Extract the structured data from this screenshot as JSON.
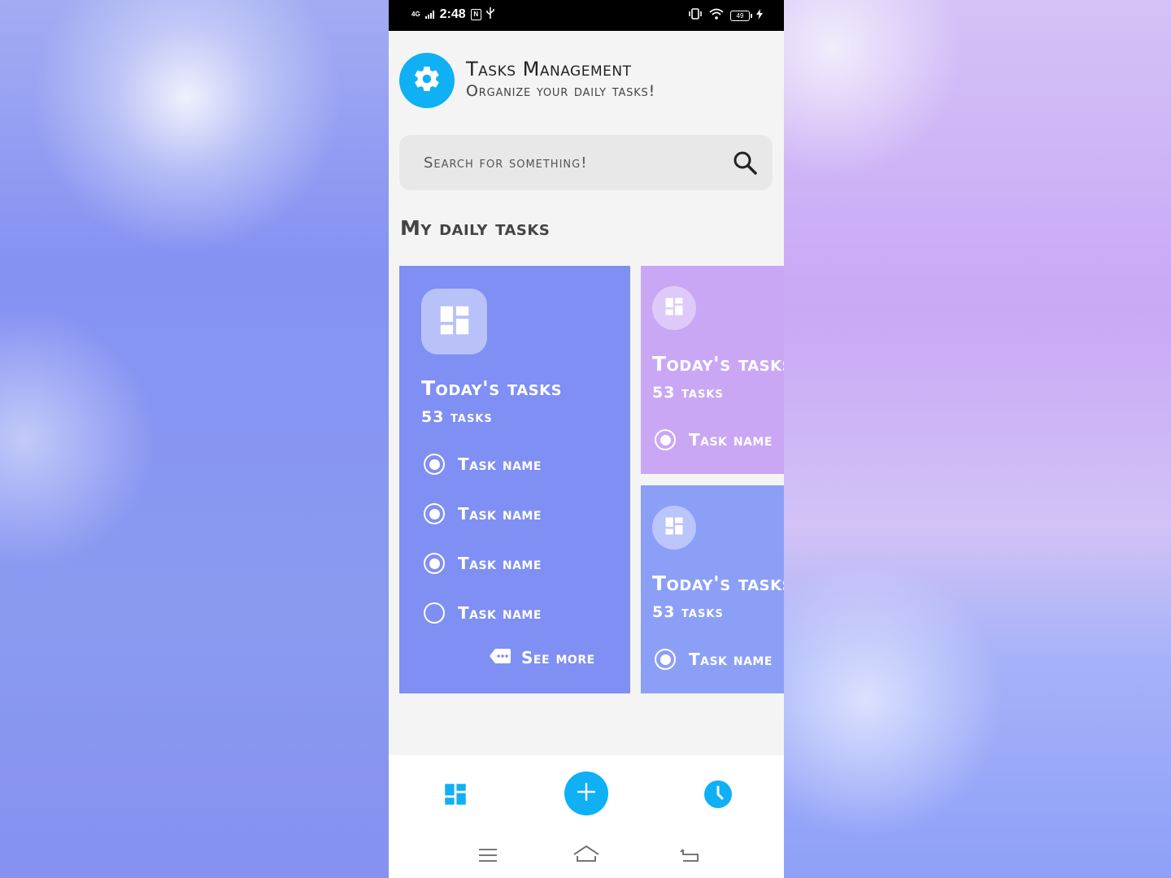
{
  "status_bar": {
    "network": "4G",
    "time": "2:48",
    "battery": "49"
  },
  "header": {
    "title": "Tasks Management",
    "subtitle": "Organize your daily tasks!",
    "icon": "gear-icon"
  },
  "search": {
    "placeholder": "Search for something!",
    "icon": "search-icon"
  },
  "section": {
    "title": "My daily tasks"
  },
  "cards": [
    {
      "title": "Today's tasks",
      "count": "53 tasks",
      "color": "#7f8ff3",
      "tasks": [
        {
          "label": "Task name",
          "checked": true
        },
        {
          "label": "Task name",
          "checked": true
        },
        {
          "label": "Task name",
          "checked": true
        },
        {
          "label": "Task name",
          "checked": false
        }
      ],
      "see_more": "See more"
    },
    {
      "title": "Today's tasks",
      "count": "53 tasks",
      "color": "#c9a7f4",
      "tasks": [
        {
          "label": "Task name",
          "checked": true
        }
      ]
    },
    {
      "title": "Today's tasks",
      "count": "53 tasks",
      "color": "#8c9ff7",
      "tasks": [
        {
          "label": "Task name",
          "checked": true
        }
      ]
    }
  ],
  "bottom_nav": {
    "items": [
      "dashboard-icon",
      "add-icon",
      "clock-icon"
    ],
    "accent": "#0fb0f4"
  }
}
